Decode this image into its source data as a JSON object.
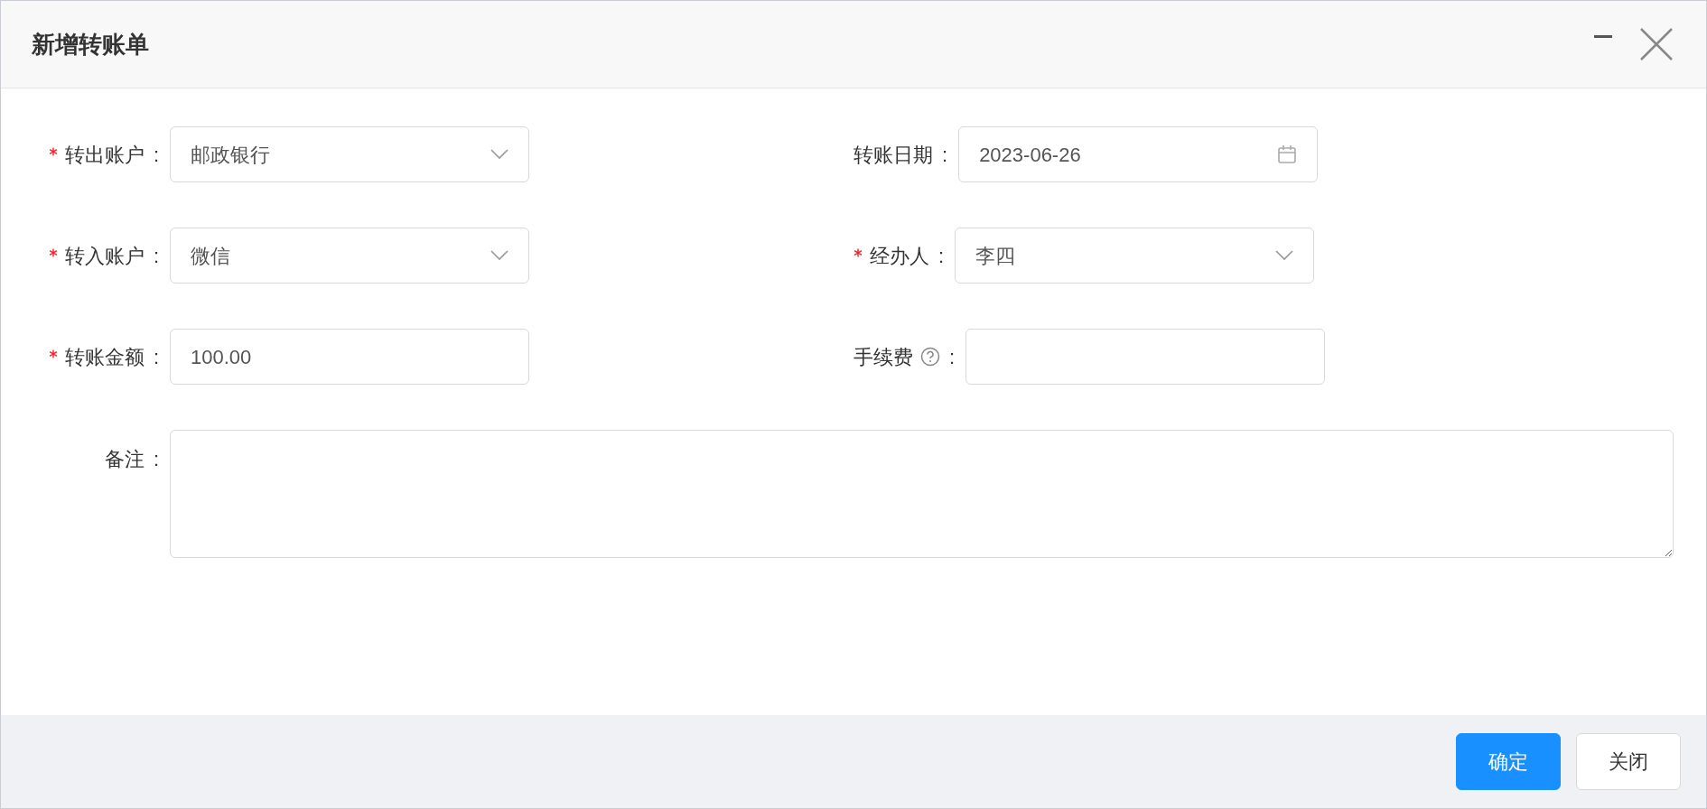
{
  "dialog": {
    "title": "新增转账单"
  },
  "rows": [
    [
      {
        "kind": "select",
        "label": "转出账户",
        "colon": ":",
        "required": true,
        "value": "邮政银行"
      },
      {
        "kind": "date",
        "label": "转账日期",
        "colon": ":",
        "required": false,
        "value": "2023-06-26"
      }
    ],
    [
      {
        "kind": "select",
        "label": "转入账户",
        "colon": ":",
        "required": true,
        "value": "微信"
      },
      {
        "kind": "select",
        "label": "经办人",
        "colon": ":",
        "required": true,
        "value": "李四"
      }
    ],
    [
      {
        "kind": "text",
        "label": "转账金额",
        "colon": ":",
        "required": true,
        "value": "100.00"
      },
      {
        "kind": "text",
        "label": "手续费",
        "colon": ":",
        "required": false,
        "help": true
      }
    ]
  ],
  "remark": {
    "label": "备注",
    "colon": ":"
  },
  "buttons": [
    {
      "label": "确定",
      "kind": "primary"
    },
    {
      "label": "关闭",
      "kind": "default"
    }
  ]
}
